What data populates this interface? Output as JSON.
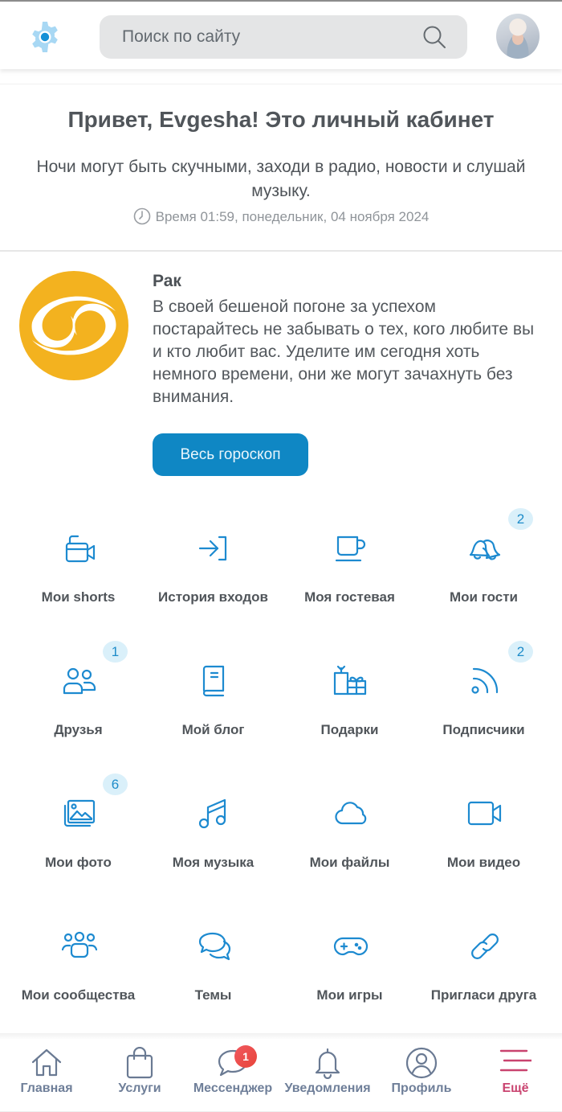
{
  "header": {
    "search_placeholder": "Поиск по сайту",
    "settings_icon": "gear-icon",
    "search_icon": "search-icon",
    "avatar_alt": "Evgesha"
  },
  "welcome": {
    "title": "Привет, Evgesha! Это личный кабинет",
    "subtitle": "Ночи могут быть скучными, заходи в радио, новости и слушай музыку.",
    "time": "Время 01:59, понедельник, 04 ноября 2024"
  },
  "horoscope": {
    "sign": "Рак",
    "text": "В своей бешеной погоне за успехом постарайтесь не забывать о тех, кого любите вы и кто любит вас. Уделите им сегодня хоть немного времени, они же могут зачахнуть без внимания.",
    "button": "Весь гороскоп",
    "icon": "cancer-zodiac-icon",
    "icon_color": "#F3B21F"
  },
  "tiles": [
    {
      "label": "Мои shorts",
      "icon": "shorts-camera-icon",
      "badge": ""
    },
    {
      "label": "История входов",
      "icon": "login-icon",
      "badge": ""
    },
    {
      "label": "Моя гостевая",
      "icon": "cup-icon",
      "badge": ""
    },
    {
      "label": "Мои гости",
      "icon": "bells-icon",
      "badge": "2"
    },
    {
      "label": "Друзья",
      "icon": "friends-icon",
      "badge": "1"
    },
    {
      "label": "Мой блог",
      "icon": "book-icon",
      "badge": ""
    },
    {
      "label": "Подарки",
      "icon": "gift-icon",
      "badge": ""
    },
    {
      "label": "Подписчики",
      "icon": "rss-icon",
      "badge": "2"
    },
    {
      "label": "Мои фото",
      "icon": "photos-icon",
      "badge": "6"
    },
    {
      "label": "Моя музыка",
      "icon": "music-note-icon",
      "badge": ""
    },
    {
      "label": "Мои файлы",
      "icon": "cloud-icon",
      "badge": ""
    },
    {
      "label": "Мои видео",
      "icon": "video-camera-icon",
      "badge": ""
    },
    {
      "label": "Мои сообщества",
      "icon": "community-icon",
      "badge": ""
    },
    {
      "label": "Темы",
      "icon": "chat-bubbles-icon",
      "badge": ""
    },
    {
      "label": "Мои игры",
      "icon": "gamepad-icon",
      "badge": ""
    },
    {
      "label": "Пригласи друга",
      "icon": "link-icon",
      "badge": ""
    }
  ],
  "tabbar": [
    {
      "label": "Главная",
      "icon": "home-icon"
    },
    {
      "label": "Услуги",
      "icon": "shopping-bag-icon"
    },
    {
      "label": "Мессенджер",
      "icon": "messenger-icon",
      "badge": "1"
    },
    {
      "label": "Уведомления",
      "icon": "bell-icon"
    },
    {
      "label": "Профиль",
      "icon": "profile-icon"
    },
    {
      "label": "Ещё",
      "icon": "menu-icon",
      "active": true
    }
  ],
  "colors": {
    "accent": "#1D8AD0",
    "button": "#0F87C4",
    "badge_bg": "#DAF0FA",
    "active_tab": "#C9436F",
    "tab_inactive": "#6F7F99",
    "notification_badge": "#EC4F4D"
  }
}
